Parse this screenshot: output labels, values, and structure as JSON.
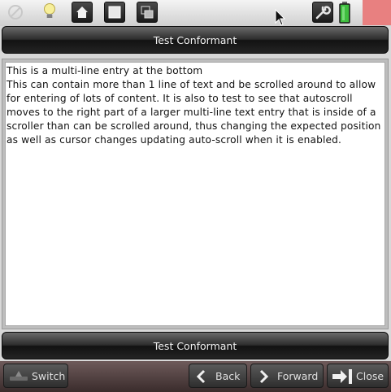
{
  "toolbar": {
    "icons": [
      "no-entry-icon",
      "lightbulb-icon",
      "home-icon",
      "square-icon",
      "window-icon",
      "wrench-icon",
      "battery-icon"
    ]
  },
  "header": {
    "title": "Test Conformant"
  },
  "entry": {
    "lines": [
      "This is a multi-line entry at the bottom",
      "This can contain more than 1 line of text and be scrolled around to allow for entering of lots of content. It is also to test to see that autoscroll moves to the right part of a larger multi-line text entry that is inside of a scroller than can be scrolled around, thus changing the expected position as well as cursor changes updating auto-scroll when it is enabled."
    ]
  },
  "footer": {
    "title": "Test Conformant"
  },
  "bottombar": {
    "switch_label": "Switch",
    "back_label": "Back",
    "forward_label": "Forward",
    "close_label": "Close"
  },
  "colors": {
    "accent_red": "#e88080",
    "battery_green": "#3fbf3f"
  }
}
